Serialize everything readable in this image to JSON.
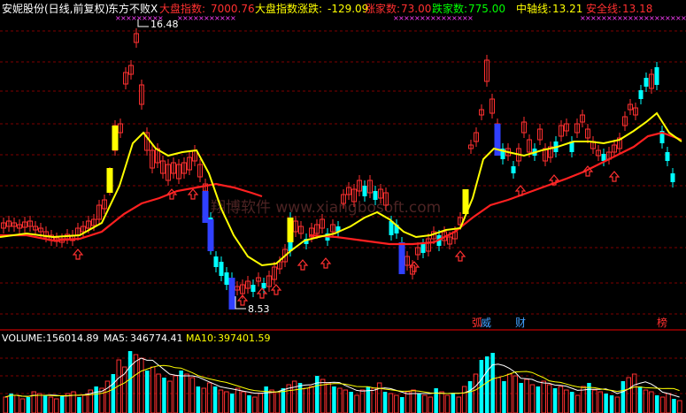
{
  "header": {
    "title": "安妮股份(日线,前复权)",
    "indicator": "东方不败X",
    "items": [
      {
        "label": "大盘指数:",
        "value": "7000.76",
        "color": "#ff3030"
      },
      {
        "label": "大盘指数涨跌:",
        "value": "-129.09",
        "color": "#ffff00"
      },
      {
        "label": "涨家数:",
        "value": "73.00",
        "color": "#ff3030"
      },
      {
        "label": "跌家数:",
        "value": "775.00",
        "color": "#00ff00"
      },
      {
        "label": "中轴线:",
        "value": "13.21",
        "color": "#ffff00"
      },
      {
        "label": "安全线:",
        "value": "13.18",
        "color": "#ff3030"
      }
    ]
  },
  "annotations": {
    "high_label": "16.48",
    "low_label": "8.53",
    "watermark": "翔博软件 www.xiangbosoft.com",
    "markers": [
      {
        "text": "弧",
        "color": "#ff3030"
      },
      {
        "text": "财",
        "color": "#40a0ff"
      },
      {
        "text": "榜",
        "color": "#ff3030"
      }
    ]
  },
  "volume_header": {
    "volume_label": "VOLUME:",
    "volume_value": "156014.89",
    "ma5_label": "MA5:",
    "ma5_value": "346774.41",
    "ma10_label": "MA10:",
    "ma10_value": "397401.59"
  },
  "colors": {
    "up": "#ff3030",
    "down_candle": "#00ffff",
    "mid_line": "#ffff00",
    "safe_line": "#ff2020",
    "volume_up": "#ff3030",
    "volume_down": "#00ffff",
    "ma5": "#ffffff",
    "ma10": "#ffff00",
    "grid": "#800000"
  }
}
